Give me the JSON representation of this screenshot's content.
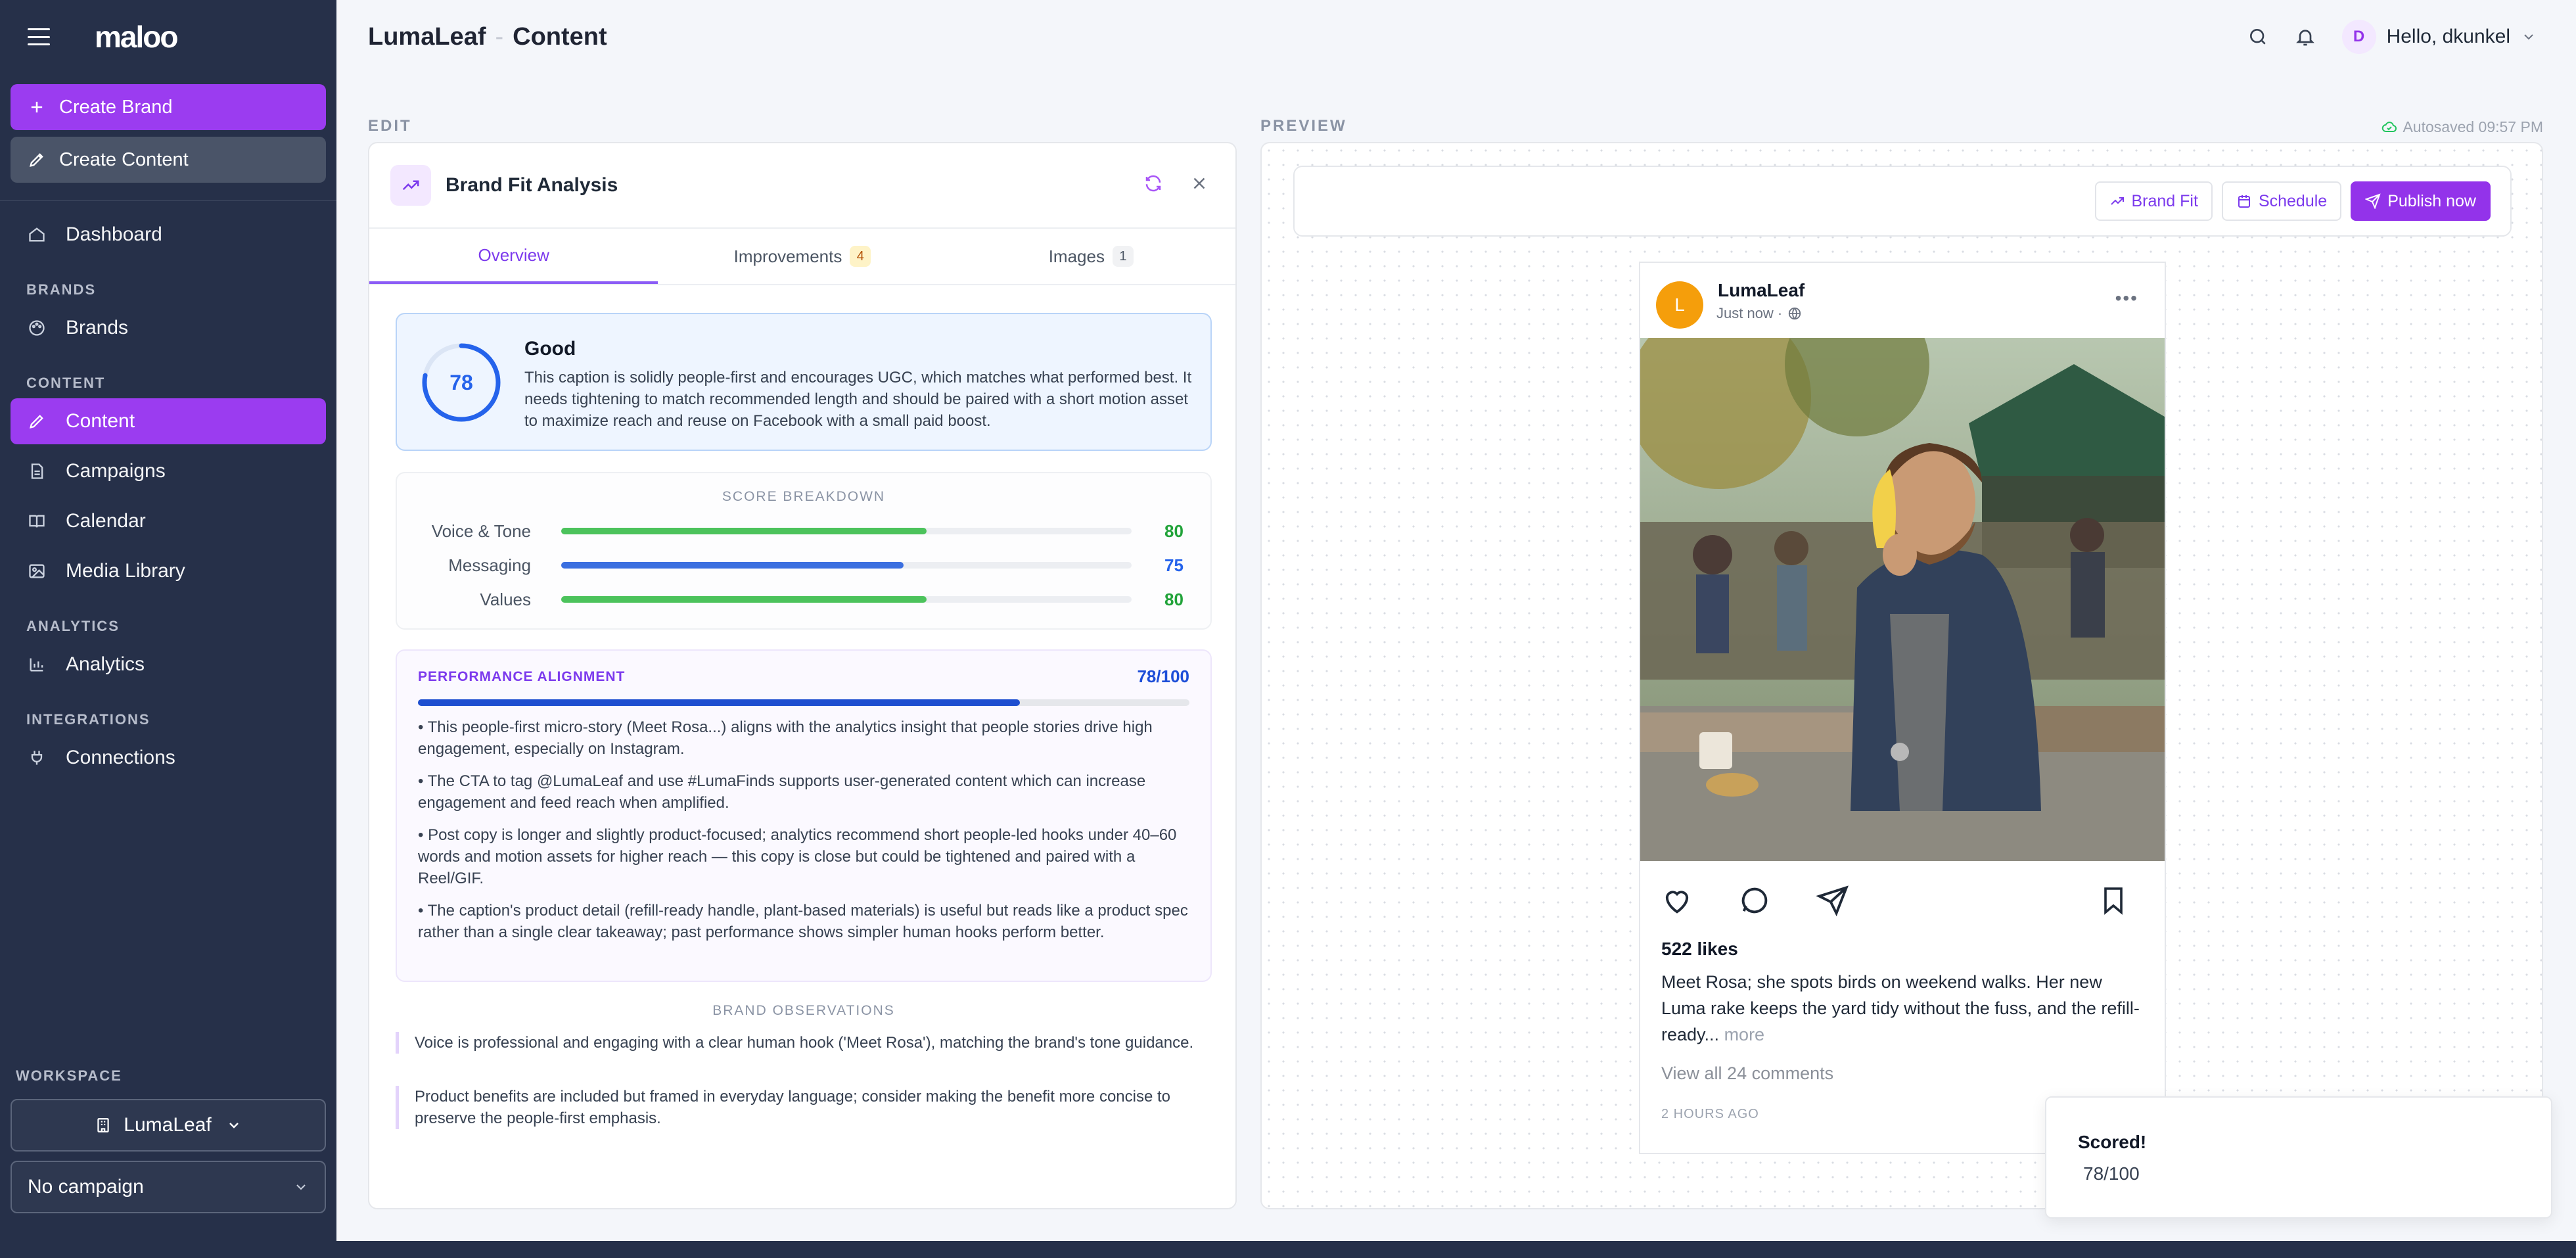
{
  "app": {
    "logo": "maloo"
  },
  "sidebar": {
    "create_brand": "Create Brand",
    "create_content": "Create Content",
    "dashboard": "Dashboard",
    "groups": {
      "brands": "BRANDS",
      "content": "CONTENT",
      "analytics": "ANALYTICS",
      "integrations": "INTEGRATIONS"
    },
    "items": {
      "brands": "Brands",
      "content": "Content",
      "campaigns": "Campaigns",
      "calendar": "Calendar",
      "media_library": "Media Library",
      "analytics": "Analytics",
      "connections": "Connections"
    },
    "workspace_label": "WORKSPACE",
    "workspace_value": "LumaLeaf",
    "campaign_value": "No campaign"
  },
  "header": {
    "brand": "LumaLeaf",
    "separator": "-",
    "section": "Content",
    "avatar_initial": "D",
    "greeting": "Hello, dkunkel"
  },
  "edit": {
    "label": "EDIT",
    "panel_title": "Brand Fit Analysis",
    "tabs": [
      {
        "label": "Overview"
      },
      {
        "label": "Improvements",
        "count": "4"
      },
      {
        "label": "Images",
        "count": "1"
      }
    ],
    "score": {
      "value": "78",
      "fraction": 0.78,
      "rating": "Good",
      "description": "This caption is solidly people-first and encourages UGC, which matches what performed best. It needs tightening to match recommended length and should be paired with a short motion asset to maximize reach and reuse on Facebook with a small paid boost."
    },
    "breakdown": {
      "title": "SCORE BREAKDOWN",
      "rows": [
        {
          "name": "Voice & Tone",
          "value": "80",
          "fraction": 0.8,
          "color": "#4cc35c"
        },
        {
          "name": "Messaging",
          "value": "75",
          "fraction": 0.75,
          "color": "#3b6fe0"
        },
        {
          "name": "Values",
          "value": "80",
          "fraction": 0.8,
          "color": "#4cc35c"
        }
      ]
    },
    "performance": {
      "title": "PERFORMANCE ALIGNMENT",
      "score": "78/100",
      "fraction": 0.78,
      "points": [
        "• This people-first micro-story (Meet Rosa...) aligns with the analytics insight that people stories drive high engagement, especially on Instagram.",
        "• The CTA to tag @LumaLeaf and use #LumaFinds supports user-generated content which can increase engagement and feed reach when amplified.",
        "• Post copy is longer and slightly product-focused; analytics recommend short people-led hooks under 40–60 words and motion assets for higher reach — this copy is close but could be tightened and paired with a Reel/GIF.",
        "• The caption's product detail (refill-ready handle, plant-based materials) is useful but reads like a product spec rather than a single clear takeaway; past performance shows simpler human hooks perform better."
      ]
    },
    "observations": {
      "title": "BRAND OBSERVATIONS",
      "items": [
        "Voice is professional and engaging with a clear human hook ('Meet Rosa'), matching the brand's tone guidance.",
        "Product benefits are included but framed in everyday language; consider making the benefit more concise to preserve the people-first emphasis."
      ]
    }
  },
  "preview": {
    "label": "PREVIEW",
    "autosave": "Autosaved 09:57 PM",
    "buttons": {
      "brand_fit": "Brand Fit",
      "schedule": "Schedule",
      "publish": "Publish now"
    },
    "post": {
      "avatar_initial": "L",
      "account": "LumaLeaf",
      "time": "Just now ·",
      "likes": "522 likes",
      "caption": "Meet Rosa; she spots birds on weekend walks. Her new Luma rake keeps the yard tidy without the fuss, and the refill-ready...",
      "more": "more",
      "comments": "View all 24 comments",
      "age": "2 HOURS AGO"
    }
  },
  "toast": {
    "title": "Scored!",
    "body": "78/100"
  },
  "colors": {
    "accent": "#9b3cf0",
    "sidebar": "#263049",
    "score_blue": "#2563eb"
  }
}
